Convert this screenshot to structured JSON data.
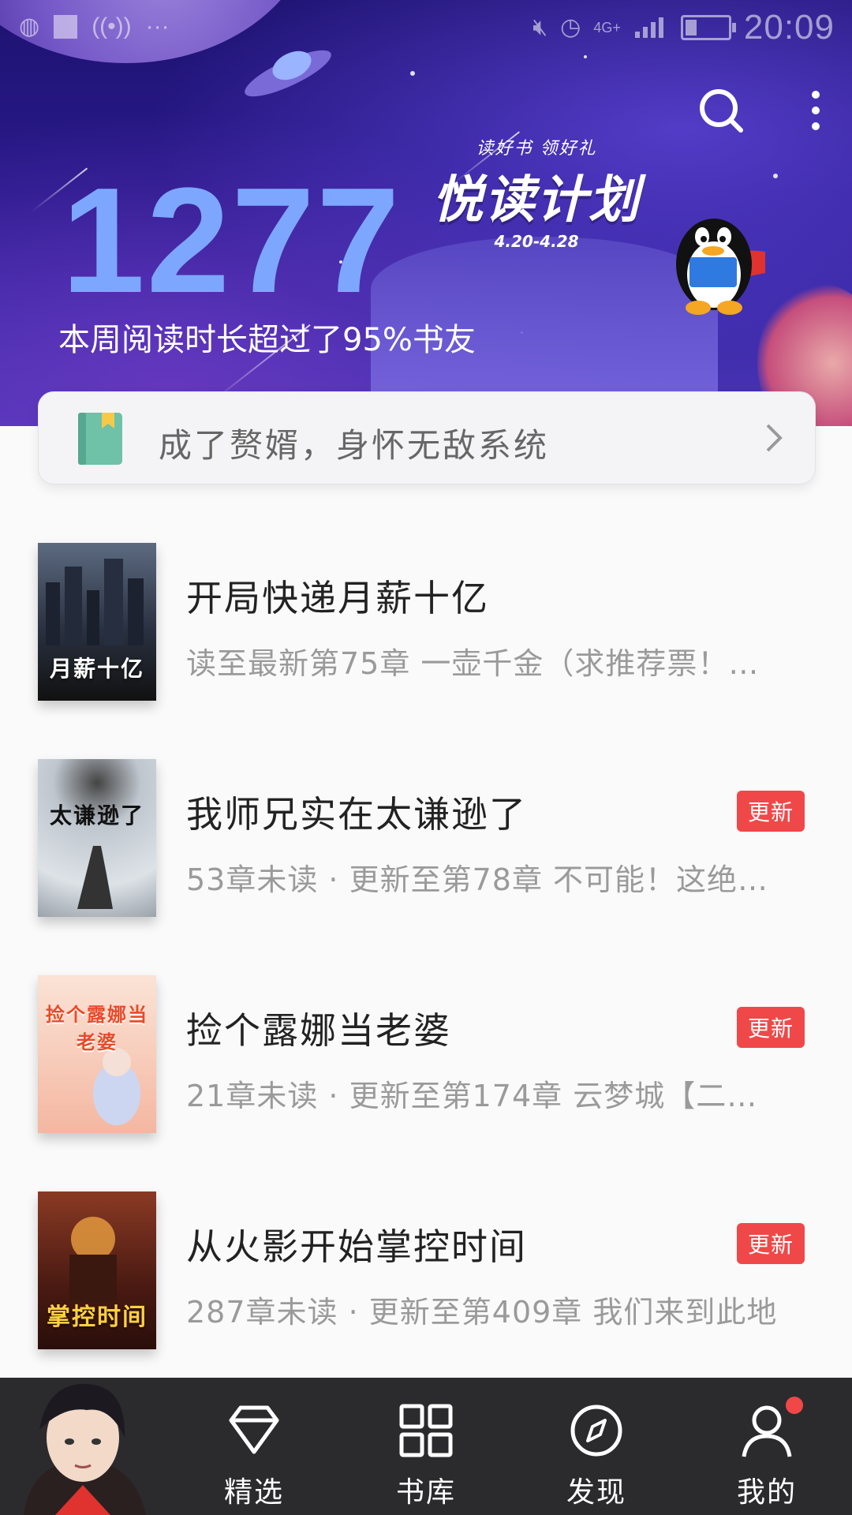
{
  "status_bar": {
    "time": "20:09",
    "network": "4G+"
  },
  "header": {
    "promo_subtitle": "读好书 领好礼",
    "promo_title": "悦读计划",
    "promo_dates": "4.20-4.28",
    "reading_minutes": "1277",
    "reading_stat": "本周阅读时长超过了95%书友"
  },
  "current_book": {
    "title": "成了赘婿，身怀无敌系统"
  },
  "books": [
    {
      "title": "开局快递月薪十亿",
      "meta": "读至最新第75章 一壶千金（求推荐票！…",
      "badge": "",
      "cover_text": "月薪十亿",
      "cover_color": "#2a3140"
    },
    {
      "title": "我师兄实在太谦逊了",
      "meta": "53章未读 · 更新至第78章 不可能！这绝…",
      "badge": "更新",
      "cover_text": "太谦逊了",
      "cover_color": "#c9cfd6"
    },
    {
      "title": "捡个露娜当老婆",
      "meta": "21章未读 · 更新至第174章 云梦城【二…",
      "badge": "更新",
      "cover_text": "捡个露娜当老婆",
      "cover_color": "#f4b7a1"
    },
    {
      "title": "从火影开始掌控时间",
      "meta": "287章未读 · 更新至第409章 我们来到此地",
      "badge": "更新",
      "cover_text": "掌控时间",
      "cover_color": "#6a2a1e"
    }
  ],
  "nav": {
    "items": [
      {
        "label": "精选",
        "icon": "diamond-icon"
      },
      {
        "label": "书库",
        "icon": "grid-icon"
      },
      {
        "label": "发现",
        "icon": "compass-icon"
      },
      {
        "label": "我的",
        "icon": "user-icon"
      }
    ]
  },
  "colors": {
    "accent_red": "#f04848",
    "banner_blue": "#2a1a8c",
    "stat_number": "#7da7ff"
  }
}
